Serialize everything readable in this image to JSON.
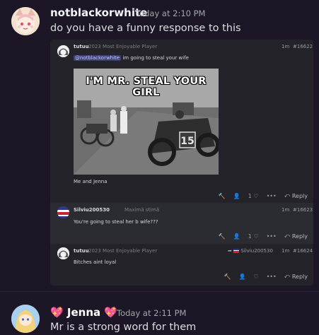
{
  "messages": [
    {
      "username": "notblackorwhite",
      "timestamp": "Today at 2:10 PM",
      "text": "do you have a funny response to this"
    },
    {
      "username": "Jenna",
      "username_decoration": "💖",
      "timestamp": "Today at 2:11 PM",
      "text": "Mr is a strong word for them"
    }
  ],
  "embed": {
    "posts": [
      {
        "user": "tutuu",
        "title": "2023 Most Enjoyable Player",
        "age": "1m",
        "id": "#16622",
        "mention": "@notblackorwhite",
        "text": "im going to steal your wife",
        "image_caption": "I'M MR. STEAL YOUR GIRL",
        "text2": "Me and Jenna",
        "reaction_count": "1",
        "reply_label": "Reply"
      },
      {
        "user": "Silviu200530",
        "title": "Maximă stimă",
        "age": "1m",
        "id": "#16623",
        "text": "You're going to steal her b wife???",
        "reaction_count": "1",
        "reply_label": "Reply"
      },
      {
        "user": "tutuu",
        "title": "2023 Most Enjoyable Player",
        "reply_to": "Silviu200530",
        "age": "1m",
        "id": "#16624",
        "text": "Bitches aint loyal",
        "reply_label": "Reply"
      }
    ]
  },
  "colors": {
    "background": "#1c1626",
    "username": "#f2f3f5",
    "timestamp": "#a3a6aa",
    "mention_bg": "#3c4275"
  }
}
